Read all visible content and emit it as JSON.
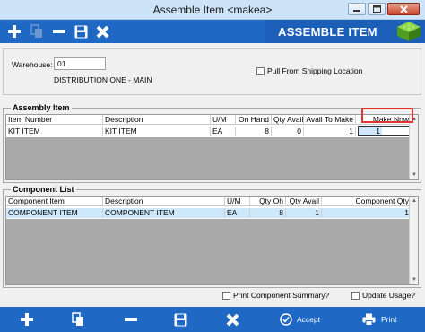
{
  "window": {
    "title": "Assemble Item <makea>"
  },
  "banner": {
    "label": "ASSEMBLE ITEM"
  },
  "form": {
    "warehouse_label": "Warehouse:",
    "warehouse_value": "01",
    "warehouse_name": "DISTRIBUTION ONE - MAIN",
    "pull_from_shipping_label": "Pull From Shipping Location",
    "pull_from_shipping_checked": false
  },
  "assembly": {
    "title": "Assembly Item",
    "columns": [
      "Item Number",
      "Description",
      "U/M",
      "On Hand",
      "Qty Avail",
      "Avail To Make",
      "Make Now"
    ],
    "rows": [
      {
        "item": "KIT ITEM",
        "desc": "KIT ITEM",
        "um": "EA",
        "onhand": "8",
        "qtyavail": "0",
        "availtomake": "1",
        "makenow": "1"
      }
    ]
  },
  "components": {
    "title": "Component List",
    "columns": [
      "Component Item",
      "Description",
      "U/M",
      "Qty Oh",
      "Qty Avail",
      "Component Qty"
    ],
    "rows": [
      {
        "item": "COMPONENT ITEM",
        "desc": "COMPONENT ITEM",
        "um": "EA",
        "qtyoh": "8",
        "qtyavail": "1",
        "compqty": "1"
      }
    ]
  },
  "options": {
    "print_summary_label": "Print Component Summary?",
    "update_usage_label": "Update Usage?"
  },
  "bottom": {
    "accept_label": "Accept",
    "print_label": "Print"
  },
  "colors": {
    "toolbar": "#1f68c4",
    "banner": "#1b5fb8",
    "highlight": "#e03535",
    "row_select": "#cde8fb"
  }
}
